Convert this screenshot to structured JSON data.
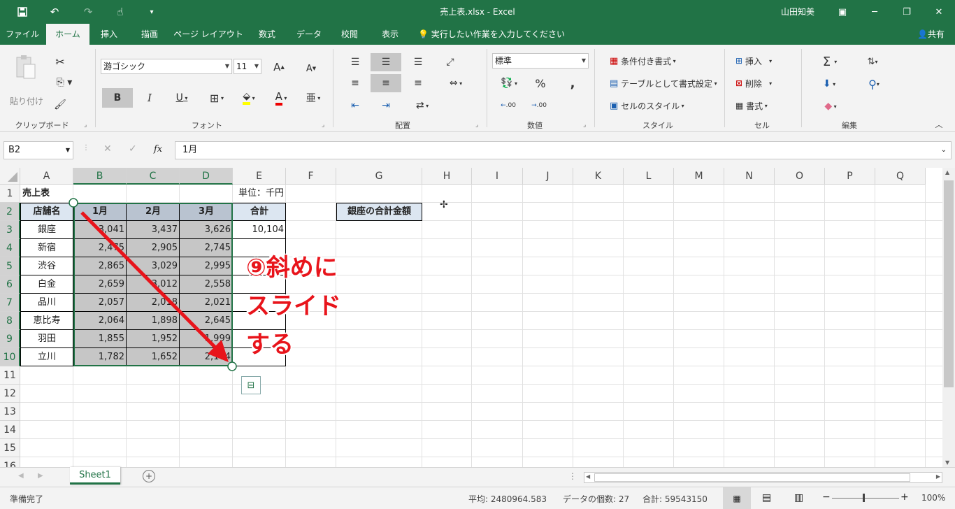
{
  "title_bar": {
    "title": "売上表.xlsx  -  Excel",
    "user": "山田知美",
    "qat_icons": [
      "save-icon",
      "undo-icon",
      "redo-icon",
      "touch-mode-icon",
      "customize-icon"
    ],
    "bg": "#217346"
  },
  "tabs": [
    "ファイル",
    "ホーム",
    "挿入",
    "描画",
    "ページ レイアウト",
    "数式",
    "データ",
    "校閲",
    "表示"
  ],
  "active_tab": "ホーム",
  "tell_me": "実行したい作業を入力してください",
  "share": "共有",
  "ribbon": {
    "clipboard": {
      "label": "クリップボード",
      "paste": "貼り付け"
    },
    "font": {
      "label": "フォント",
      "name": "游ゴシック",
      "size": "11",
      "bold": "B",
      "italic": "I",
      "underline": "U",
      "grow": "A",
      "shrink": "A"
    },
    "alignment": {
      "label": "配置"
    },
    "number": {
      "label": "数値",
      "format": "標準",
      "percent": "%",
      "comma": ",",
      "inc_decimal": ".00",
      "dec_decimal": ".00"
    },
    "styles": {
      "label": "スタイル",
      "conditional": "条件付き書式",
      "table": "テーブルとして書式設定",
      "cell_styles": "セルのスタイル"
    },
    "cells": {
      "label": "セル",
      "insert": "挿入",
      "delete": "削除",
      "format": "書式"
    },
    "editing": {
      "label": "編集",
      "sum": "Σ"
    }
  },
  "formula_bar": {
    "name_box": "B2",
    "fx": "fx",
    "value": "1月"
  },
  "columns": [
    "A",
    "B",
    "C",
    "D",
    "E",
    "F",
    "G",
    "H",
    "I",
    "J",
    "K",
    "L",
    "M",
    "N",
    "O",
    "P",
    "Q"
  ],
  "rows": [
    "1",
    "2",
    "3",
    "4",
    "5",
    "6",
    "7",
    "8",
    "9",
    "10",
    "11",
    "12",
    "13",
    "14",
    "15",
    "16"
  ],
  "sheet": {
    "title": "売上表",
    "unit": "単位：千円",
    "headers": [
      "店舗名",
      "1月",
      "2月",
      "3月",
      "合計"
    ],
    "stores": [
      "銀座",
      "新宿",
      "渋谷",
      "白金",
      "品川",
      "恵比寿",
      "羽田",
      "立川"
    ],
    "values": [
      [
        "3,041",
        "3,437",
        "3,626"
      ],
      [
        "2,475",
        "2,905",
        "2,745"
      ],
      [
        "2,865",
        "3,029",
        "2,995"
      ],
      [
        "2,659",
        "3,012",
        "2,558"
      ],
      [
        "2,057",
        "2,018",
        "2,021"
      ],
      [
        "2,064",
        "1,898",
        "2,645"
      ],
      [
        "1,855",
        "1,952",
        "1,999"
      ],
      [
        "1,782",
        "1,652",
        "2,174"
      ]
    ],
    "total_ginza": "10,104",
    "g_label": "銀座の合計金額"
  },
  "annotation": {
    "lines": [
      "⑨斜めに",
      "スライド",
      "する"
    ],
    "color": "#e8141b"
  },
  "sheet_tab": "Sheet1",
  "status": {
    "ready": "準備完了",
    "average": "平均: 2480964.583",
    "count": "データの個数: 27",
    "sum": "合計: 59543150",
    "zoom": "100%"
  }
}
